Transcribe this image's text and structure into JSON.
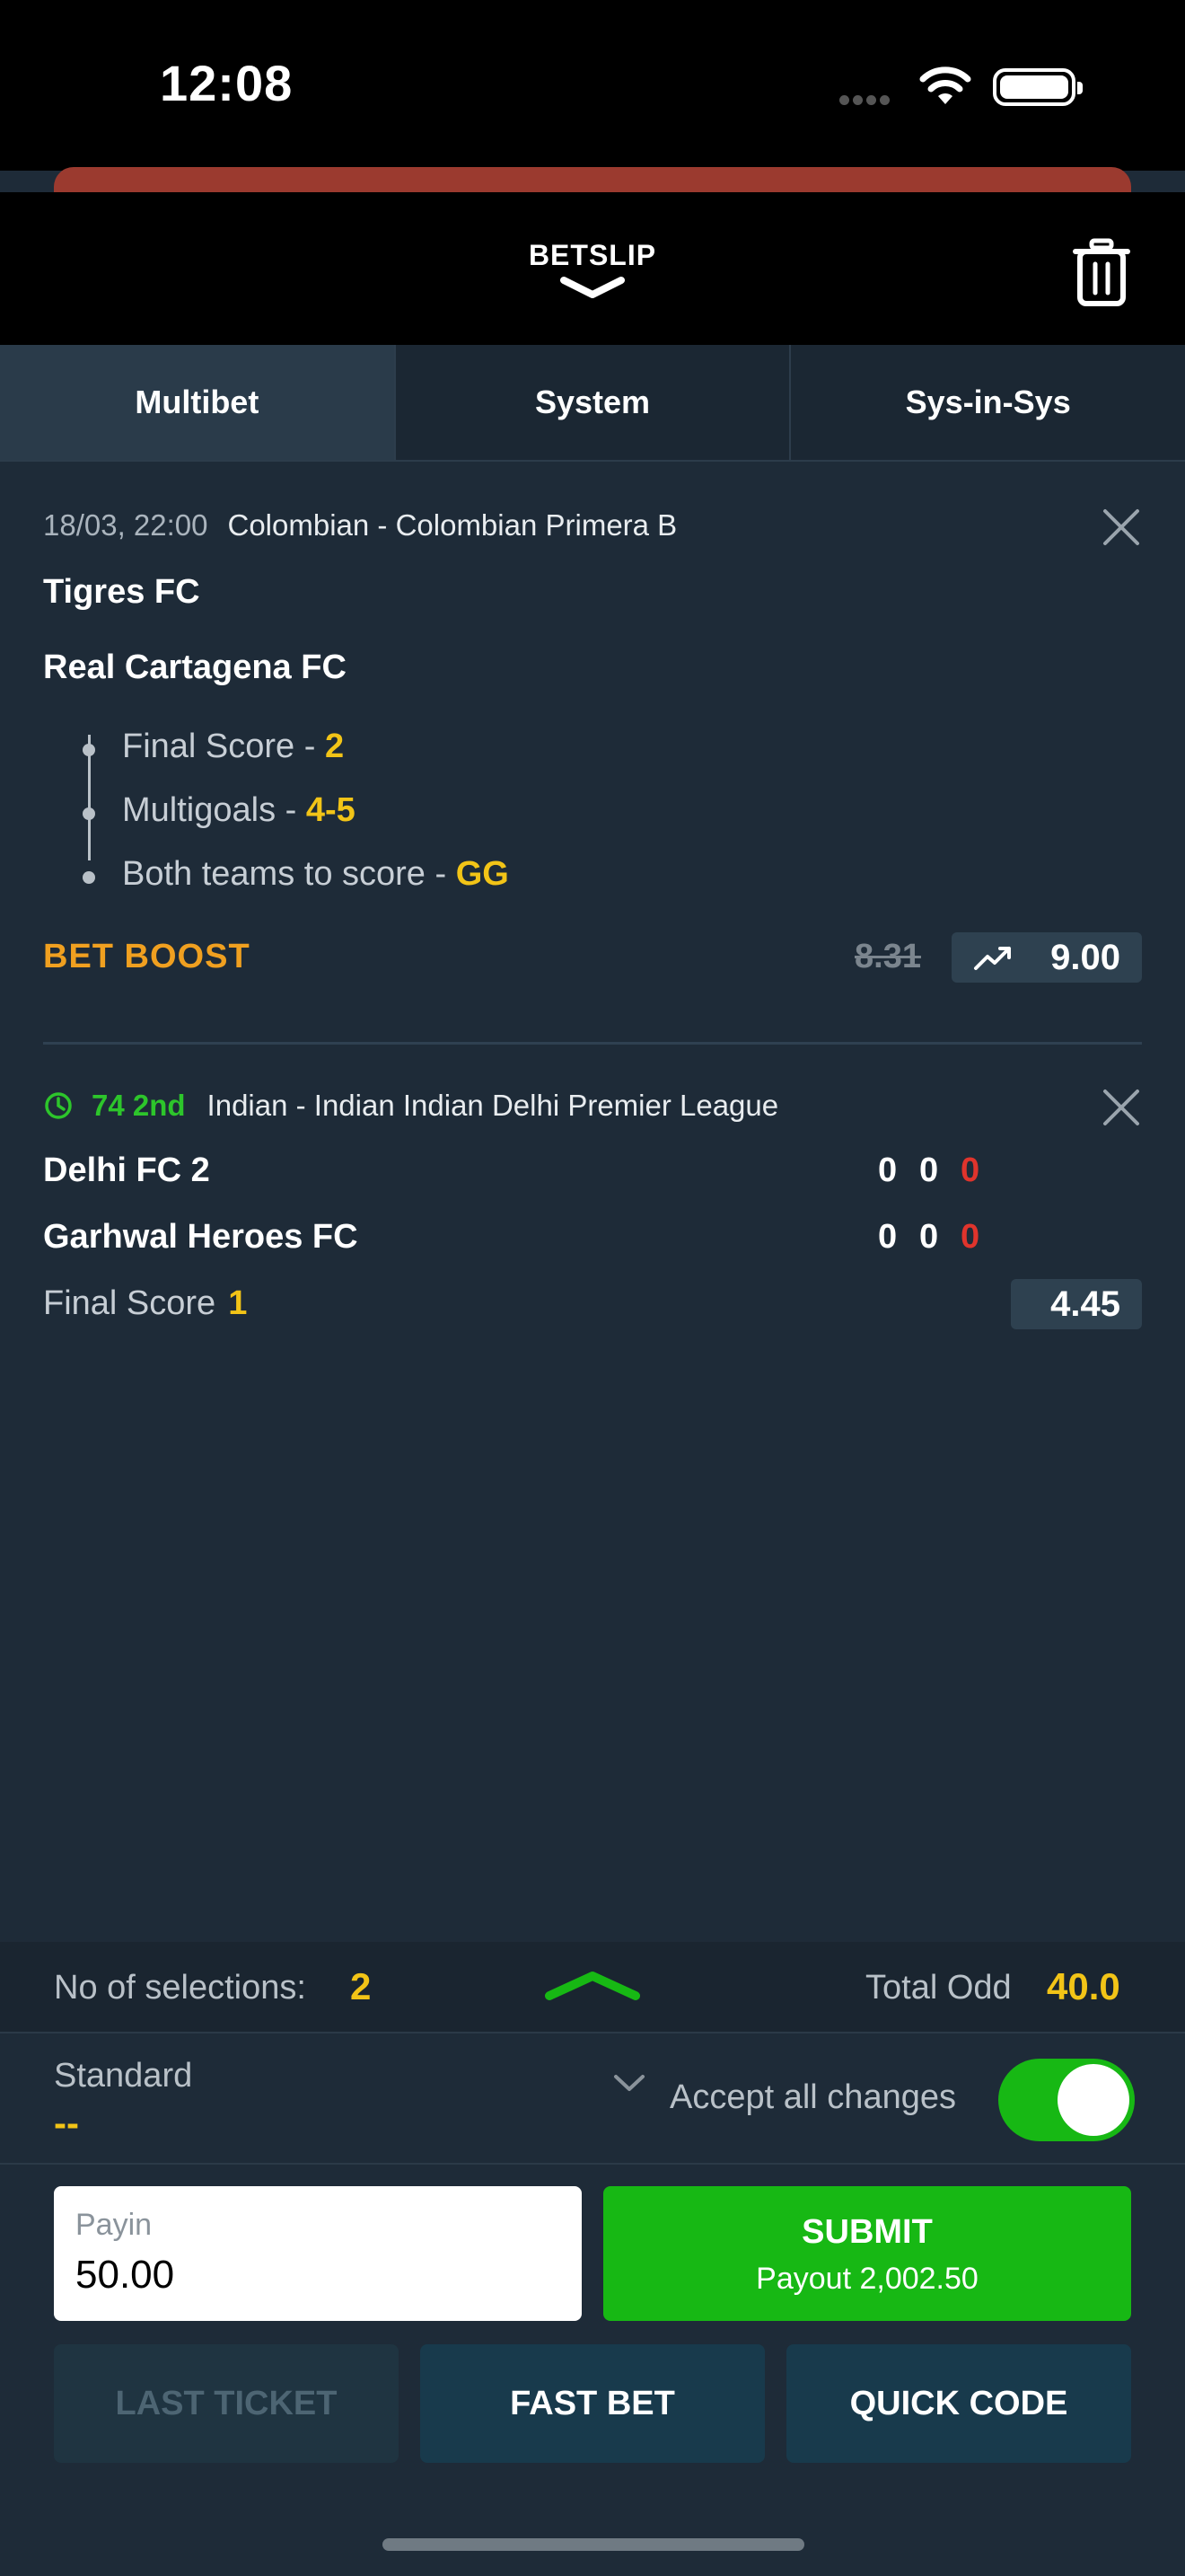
{
  "status_bar": {
    "time": "12:08"
  },
  "header": {
    "title": "BETSLIP"
  },
  "tabs": [
    {
      "label": "Multibet",
      "active": true
    },
    {
      "label": "System",
      "active": false
    },
    {
      "label": "Sys-in-Sys",
      "active": false
    }
  ],
  "selections": [
    {
      "datetime": "18/03, 22:00",
      "league": "Colombian - Colombian Primera B",
      "home": "Tigres FC",
      "away": "Real Cartagena FC",
      "legs": [
        {
          "market": "Final Score - ",
          "value": "2"
        },
        {
          "market": "Multigoals - ",
          "value": "4-5"
        },
        {
          "market": "Both teams to score - ",
          "value": "GG"
        }
      ],
      "boost_label": "BET BOOST",
      "old_odd": "8.31",
      "odd": "9.00"
    },
    {
      "live_time": "74 2nd",
      "league": "Indian - Indian Indian Delhi Premier League",
      "home": "Delhi FC 2",
      "away": "Garhwal Heroes FC",
      "home_scores": [
        "0",
        "0",
        "0"
      ],
      "away_scores": [
        "0",
        "0",
        "0"
      ],
      "market": "Final Score",
      "value": "1",
      "odd": "4.45"
    }
  ],
  "summary": {
    "selections_label": "No of selections:",
    "selections_count": "2",
    "total_odd_label": "Total Odd",
    "total_odd": "40.0"
  },
  "ticket_type": {
    "label": "Standard",
    "value": "--",
    "accept_label": "Accept all changes",
    "accept_on": true
  },
  "payin": {
    "label": "Payin",
    "value": "50.00"
  },
  "submit": {
    "label": "SUBMIT",
    "payout": "Payout 2,002.50"
  },
  "actions": {
    "last_ticket": "LAST TICKET",
    "fast_bet": "FAST BET",
    "quick_code": "QUICK CODE"
  },
  "colors": {
    "accent_green": "#17b814",
    "odd_yellow": "#f2c417",
    "boost_orange": "#f0a020",
    "live_red": "#e0342c"
  }
}
